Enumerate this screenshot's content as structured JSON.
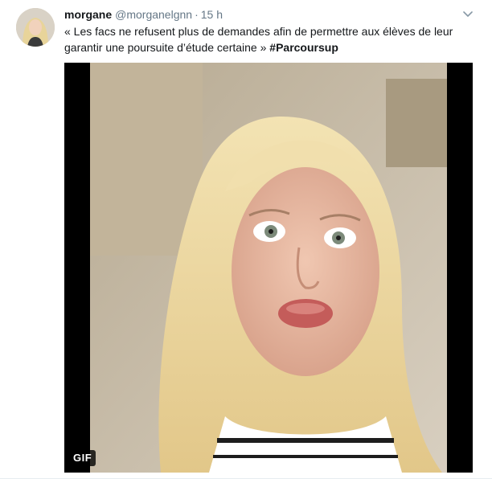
{
  "tweet": {
    "fullname": "morgane",
    "username": "@morganelgnn",
    "separator": "·",
    "time": "15 h",
    "text_line1": "« Les facs ne refusent plus de demandes afin de permettre aux élèves de leur",
    "text_line2": "garantir une poursuite d’étude certaine » ",
    "hashtag": "#Parcoursup",
    "media_badge": "GIF"
  },
  "icons": {
    "menu": "chevron-down-icon"
  },
  "colors": {
    "text": "#14171a",
    "secondary": "#657786",
    "caret": "#8899a6",
    "media_bg": "#000000"
  }
}
